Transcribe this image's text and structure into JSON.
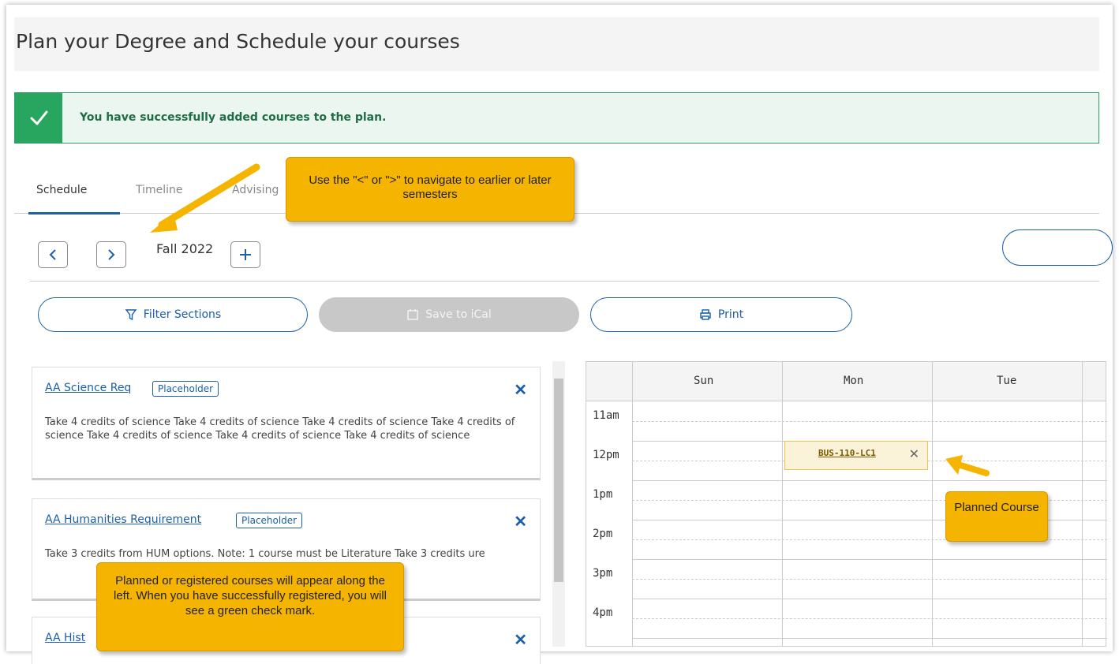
{
  "header": {
    "title": "Plan your Degree and Schedule your courses"
  },
  "alert": {
    "message": "You have successfully added courses to the plan."
  },
  "tabs": [
    {
      "label": "Schedule"
    },
    {
      "label": "Timeline"
    },
    {
      "label": "Advising"
    }
  ],
  "term": {
    "label": "Fall 2022"
  },
  "actions": {
    "filter": "Filter Sections",
    "save_ical": "Save to iCal",
    "print": "Print"
  },
  "courses": [
    {
      "title": "AA Science Req",
      "badge": "Placeholder",
      "desc": "Take 4 credits of science Take 4 credits of science Take 4 credits of science Take 4 credits of science Take 4 credits of science Take 4 credits of science Take 4 credits of science"
    },
    {
      "title": "AA Humanities Requirement",
      "badge": "Placeholder",
      "desc": "Take 3 credits from HUM options. Note: 1 course must be Literature Take 3 credits ure"
    },
    {
      "title": "AA Hist"
    }
  ],
  "calendar": {
    "days": [
      "Sun",
      "Mon",
      "Tue"
    ],
    "times": [
      "11am",
      "12pm",
      "1pm",
      "2pm",
      "3pm",
      "4pm"
    ],
    "event": {
      "code": "BUS-110-LC1"
    }
  },
  "callouts": {
    "nav": "Use the \"<\" or \">\" to navigate to earlier or later semesters",
    "planned": "Planned Course",
    "left": "Planned or registered courses will appear along the left.  When you have successfully registered, you will see a green check mark."
  },
  "colors": {
    "brand_blue": "#1a5fa8",
    "success_green": "#28a55f",
    "callout_yellow": "#f5b400"
  }
}
